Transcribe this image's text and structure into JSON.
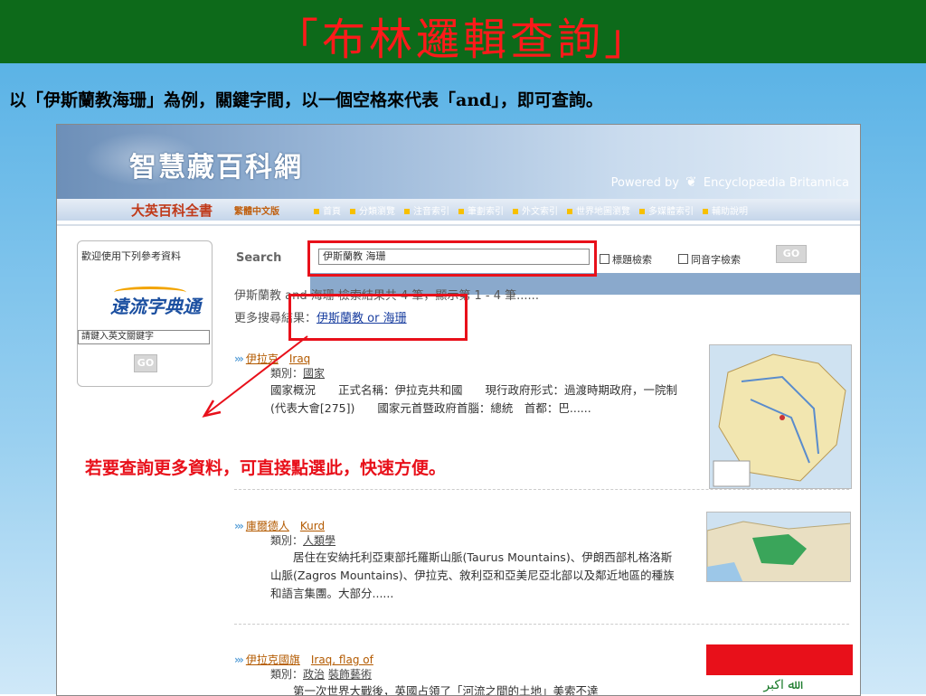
{
  "slide": {
    "title": "「布林邏輯查詢」",
    "subtitle": "以「伊斯蘭教海珊」為例，關鍵字間，以一個空格來代表「and」，即可查詢。",
    "annotation": "若要查詢更多資料，可直接點選此，快速方便。"
  },
  "site": {
    "name": "智慧藏百科網",
    "powered_by": "Powered by",
    "partner": "Encyclopædia Britannica",
    "brand": "大英百科全書",
    "edition": "繁體中文版",
    "nav": [
      "首頁",
      "分類瀏覽",
      "注音索引",
      "筆劃索引",
      "外文索引",
      "世界地圖瀏覽",
      "多媒體索引",
      "輔助說明"
    ]
  },
  "sidebar": {
    "heading": "歡迎使用下列參考資料",
    "dict_logo": "遠流字典通",
    "keyword_placeholder": "請鍵入英文關鍵字",
    "go": "GO"
  },
  "search": {
    "label": "Search",
    "query": "伊斯蘭教 海珊",
    "option1": "標題檢索",
    "option2": "同音字檢索",
    "go": "GO",
    "summary": "伊斯蘭教 and 海珊 檢索結果共 4 筆，顯示第 1 - 4 筆......",
    "more_prefix": "更多搜尋結果：",
    "more_link": "伊斯蘭教 or 海珊"
  },
  "results": [
    {
      "title_zh": "伊拉克",
      "title_en": "Iraq",
      "category_label": "類別：",
      "categories": [
        "國家"
      ],
      "desc": "國家概況　　正式名稱：伊拉克共和國　　現行政府形式：過渡時期政府，一院制(代表大會[275])　　國家元首暨政府首腦：總統　首都：巴......"
    },
    {
      "title_zh": "庫爾德人",
      "title_en": "Kurd",
      "category_label": "類別：",
      "categories": [
        "人類學"
      ],
      "desc": "　　居住在安納托利亞東部托羅斯山脈(Taurus Mountains)、伊朗西部札格洛斯山脈(Zagros Mountains)、伊拉克、敘利亞和亞美尼亞北部以及鄰近地區的種族和語言集團。大部分......"
    },
    {
      "title_zh": "伊拉克國旗",
      "title_en": "Iraq, flag of",
      "category_label": "類別：",
      "categories": [
        "政治",
        "裝飾藝術"
      ],
      "desc": "　　第一次世界大戰後，英國占領了「河流之間的土地」美索不達"
    }
  ],
  "colors": {
    "header_green": "#0d6a1a",
    "title_red": "#ff1a1a",
    "highlight_red": "#e8101a",
    "link_blue": "#1a3fa0"
  }
}
